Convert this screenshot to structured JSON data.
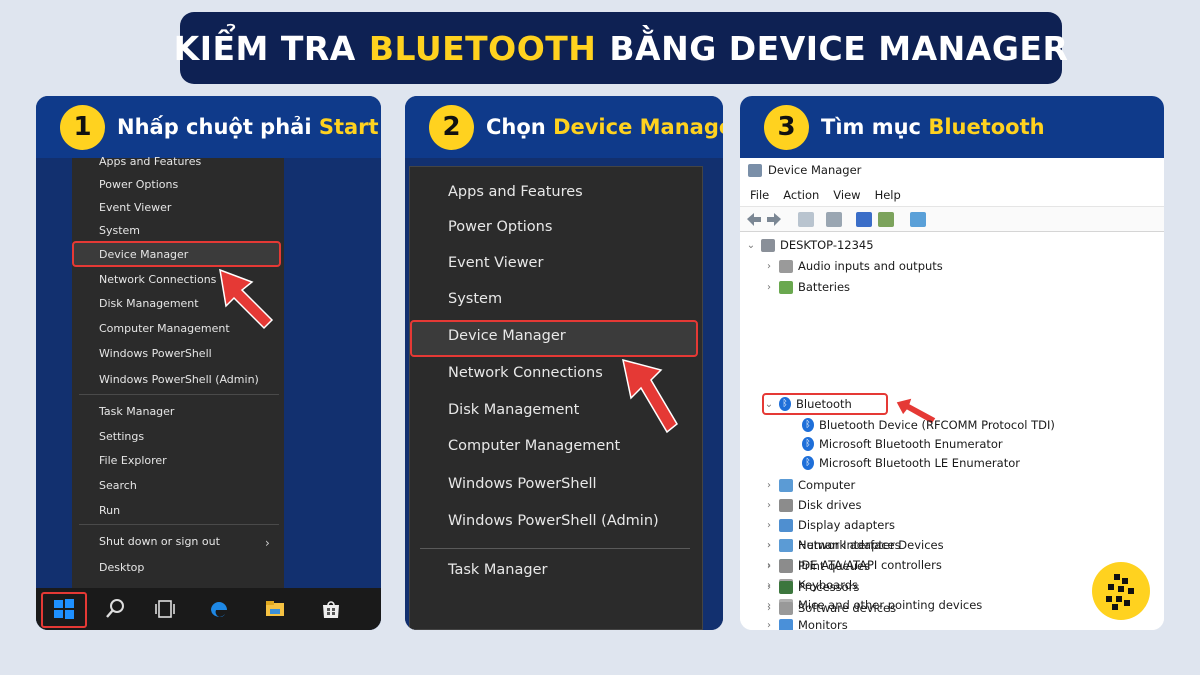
{
  "title": {
    "part1": "KIỂM TRA",
    "highlight": "BLUETOOTH",
    "part2": "BẰNG DEVICE MANAGER"
  },
  "panels": [
    {
      "num": "1",
      "label": "Nhấp chuột phải",
      "highlight": "Start"
    },
    {
      "num": "2",
      "label": "Chọn",
      "highlight": "Device Manager"
    },
    {
      "num": "3",
      "label": "Tìm mục",
      "highlight": "Bluetooth"
    }
  ],
  "menu1": {
    "items": [
      "Apps and Features",
      "Power Options",
      "Event Viewer",
      "System",
      "Device Manager",
      "Network Connections",
      "Disk Management",
      "Computer Management",
      "Windows PowerShell",
      "Windows PowerShell (Admin)",
      "Task Manager",
      "Settings",
      "File Explorer",
      "Search",
      "Run",
      "Shut down or sign out",
      "Desktop"
    ]
  },
  "menu2": {
    "items": [
      "Apps and Features",
      "Power Options",
      "Event Viewer",
      "System",
      "Device Manager",
      "Network Connections",
      "Disk Management",
      "Computer Management",
      "Windows PowerShell",
      "Windows PowerShell (Admin)",
      "Task Manager"
    ]
  },
  "devmgr": {
    "title": "Device Manager",
    "menu": [
      "File",
      "Action",
      "View",
      "Help"
    ],
    "root": "DESKTOP-12345",
    "categories_before": [
      "Audio inputs and outputs",
      "Batteries"
    ],
    "bluetooth": "Bluetooth",
    "bt_children": [
      "Bluetooth Device (RFCOMM Protocol TDI)",
      "Microsoft Bluetooth Enumerator",
      "Microsoft Bluetooth LE Enumerator"
    ],
    "categories_after": [
      "Computer",
      "Disk drives",
      "Display adapters",
      "Human Interface Devices",
      "IDE ATA/ATAPI controllers",
      "Keyboards",
      "Mice and other pointing devices",
      "Monitors",
      "Network adapters",
      "Print queues",
      "Processors",
      "Software devices"
    ]
  },
  "colors": {
    "accent": "#ffd21f",
    "highlight_box": "#e53935",
    "banner": "#0e2153"
  }
}
